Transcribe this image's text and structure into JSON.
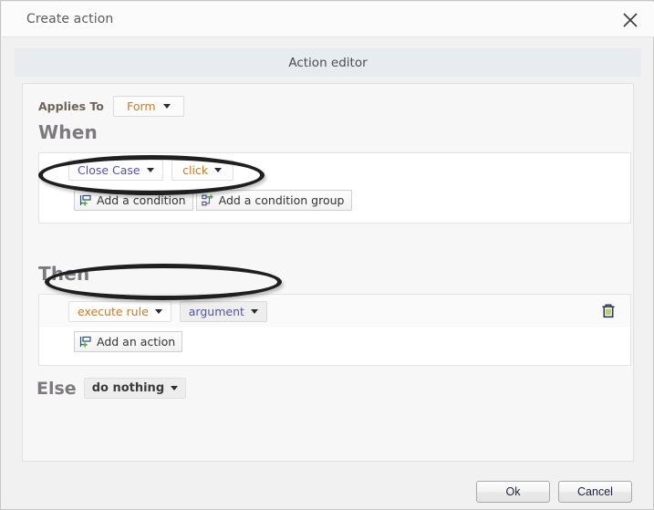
{
  "window": {
    "title": "Create action",
    "close_icon": "close-icon"
  },
  "editor_band": {
    "label": "Action editor"
  },
  "applies_to": {
    "label": "Applies To",
    "value": "Form"
  },
  "when": {
    "heading": "When",
    "condition": {
      "subject": "Close Case",
      "event": "click"
    },
    "add_condition": {
      "label": "Add a condition",
      "icon": "add-condition-icon"
    },
    "add_condition_group": {
      "label": "Add a condition group",
      "icon": "add-condition-group-icon"
    }
  },
  "then": {
    "heading": "Then",
    "action": {
      "operation": "execute rule",
      "argument": "argument",
      "delete_icon": "trash-icon"
    },
    "add_action": {
      "label": "Add an action",
      "icon": "add-action-icon"
    }
  },
  "else": {
    "heading": "Else",
    "value": "do nothing"
  },
  "footer": {
    "ok_label": "Ok",
    "cancel_label": "Cancel"
  },
  "colors": {
    "subject_text": "#5353a6",
    "event_text": "#cc7a22",
    "heading_text": "#7c7a7e",
    "band_bg": "#e8ebef",
    "annotation_stroke": "#1f1f1f"
  },
  "annotations": [
    {
      "name": "highlight-ellipse-when",
      "shape": "ellipse"
    },
    {
      "name": "highlight-ellipse-then",
      "shape": "ellipse"
    }
  ]
}
